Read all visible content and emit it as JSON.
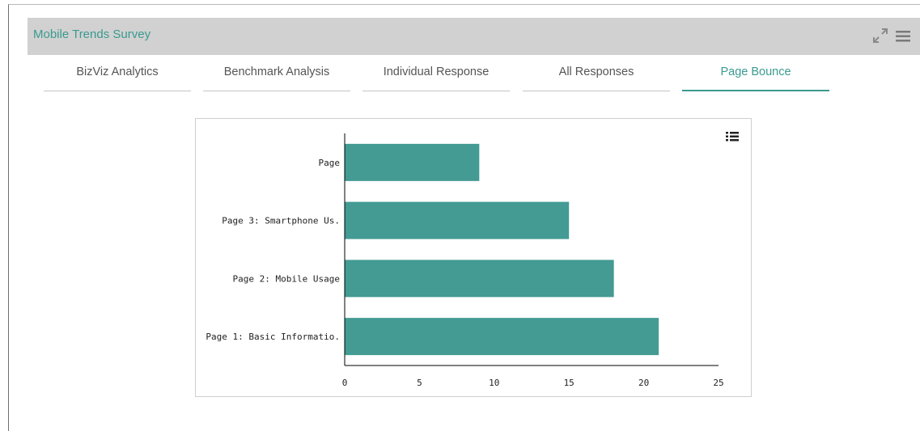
{
  "header": {
    "title": "Mobile Trends Survey"
  },
  "icons": {
    "expand": "expand-arrows-icon",
    "menu": "hamburger-menu-icon",
    "chart_menu": "list-icon"
  },
  "tabs": [
    {
      "label": "BizViz Analytics",
      "active": false
    },
    {
      "label": "Benchmark Analysis",
      "active": false
    },
    {
      "label": "Individual Response",
      "active": false
    },
    {
      "label": "All Responses",
      "active": false
    },
    {
      "label": "Page Bounce",
      "active": true
    }
  ],
  "colors": {
    "accent": "#3a9a8f",
    "bar": "#439b93",
    "header_bg": "#d1d1d1"
  },
  "chart_data": {
    "type": "bar",
    "orientation": "horizontal",
    "categories": [
      "Page",
      "Page 3: Smartphone Us.",
      "Page 2: Mobile Usage",
      "Page 1: Basic Informatio."
    ],
    "values": [
      9,
      15,
      18,
      21
    ],
    "xlim": [
      0,
      25
    ],
    "xticks": [
      "0",
      "5",
      "10",
      "15",
      "20",
      "25"
    ],
    "title": "",
    "xlabel": "",
    "ylabel": "",
    "grid": false
  }
}
